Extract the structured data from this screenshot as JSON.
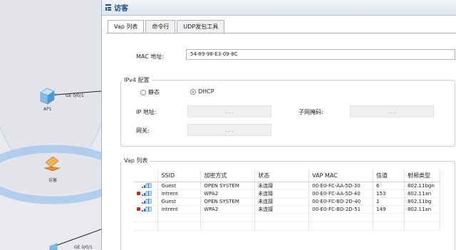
{
  "topology": {
    "ap1_port": "GE 0/0/1",
    "ap1_label": "AP1",
    "visitor_label": "访客",
    "bottom_port": "GE 0/0/1"
  },
  "dialog": {
    "title": "访客",
    "tabs": [
      "Vap 列表",
      "命令行",
      "UDP发包工具"
    ],
    "mac_label": "MAC 地址:",
    "mac_value": "54-89-98-E3-09-8C",
    "ipv4_group": "IPv4 配置",
    "radio_static": "静态",
    "radio_dhcp": "DHCP",
    "ip_label": "IP 地址:",
    "mask_label": "子网掩码:",
    "gateway_label": "网关:",
    "vap_group": "Vap 列表",
    "ip_dots": ".   .   ."
  },
  "vap_table": {
    "columns": [
      "SSID",
      "加密方式",
      "状态",
      "VAP MAC",
      "信道",
      "射频类型"
    ],
    "rows": [
      {
        "locked": false,
        "ssid": "Guest",
        "enc": "OPEN SYSTEM",
        "state": "未连接",
        "mac": "00-E0-FC-AA-5D-30",
        "channel": "6",
        "radio": "802.11bgn"
      },
      {
        "locked": true,
        "ssid": "intrent",
        "enc": "WPA2",
        "state": "未连接",
        "mac": "00-E0-FC-AA-5D-40",
        "channel": "153",
        "radio": "802.11an"
      },
      {
        "locked": false,
        "ssid": "Guest",
        "enc": "OPEN SYSTEM",
        "state": "未连接",
        "mac": "00-E0-FC-BD-2D-40",
        "channel": "1",
        "radio": "802.11bg"
      },
      {
        "locked": true,
        "ssid": "intrent",
        "enc": "WPA2",
        "state": "未连接",
        "mac": "00-E0-FC-BD-2D-51",
        "channel": "149",
        "radio": "802.11an"
      }
    ]
  },
  "colors": {
    "title_text": "#1e4a86",
    "wifi_zone": "#9ec3ea",
    "lock": "#c62828",
    "signal": "#1e6fd0"
  }
}
